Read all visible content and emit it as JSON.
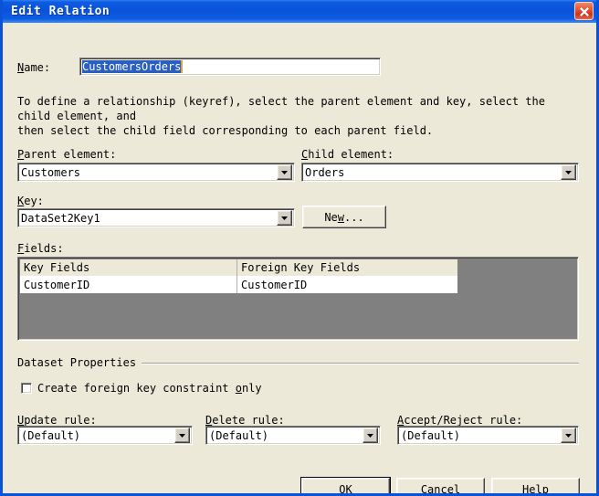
{
  "window": {
    "title": "Edit Relation",
    "close_icon": "close-icon",
    "titlebar_color": "#0a52d8",
    "client_color": "#ece9d8"
  },
  "name_field": {
    "label": "Name:",
    "label_accel": "N",
    "value": "CustomersOrders",
    "selection_color": "#2a5fc0"
  },
  "description": "To define a relationship (keyref), select the parent element and key, select the child element, and\nthen select the child field corresponding to each parent field.",
  "parent_element": {
    "label": "Parent element:",
    "label_accel": "P",
    "value": "Customers"
  },
  "child_element": {
    "label": "Child element:",
    "label_accel": "C",
    "value": "Orders"
  },
  "key": {
    "label": "Key:",
    "label_accel": "K",
    "value": "DataSet2Key1",
    "new_button": "New...",
    "new_button_accel": "w"
  },
  "fields": {
    "label": "Fields:",
    "label_accel": "F",
    "columns": [
      "Key Fields",
      "Foreign Key Fields"
    ],
    "rows": [
      {
        "key_field": "CustomerID",
        "foreign_key_field": "CustomerID"
      }
    ],
    "empty_area_color": "#808080"
  },
  "dataset_properties": {
    "group_label": "Dataset Properties",
    "checkbox": {
      "label": "Create foreign key constraint only",
      "label_accel": "o",
      "checked": false
    },
    "update_rule": {
      "label": "Update rule:",
      "label_accel": "U",
      "value": "(Default)"
    },
    "delete_rule": {
      "label": "Delete rule:",
      "label_accel": "D",
      "value": "(Default)"
    },
    "accept_reject_rule": {
      "label": "Accept/Reject rule:",
      "label_accel": "A",
      "value": "(Default)"
    }
  },
  "buttons": {
    "ok": "OK",
    "cancel": "Cancel",
    "help": "Help"
  }
}
